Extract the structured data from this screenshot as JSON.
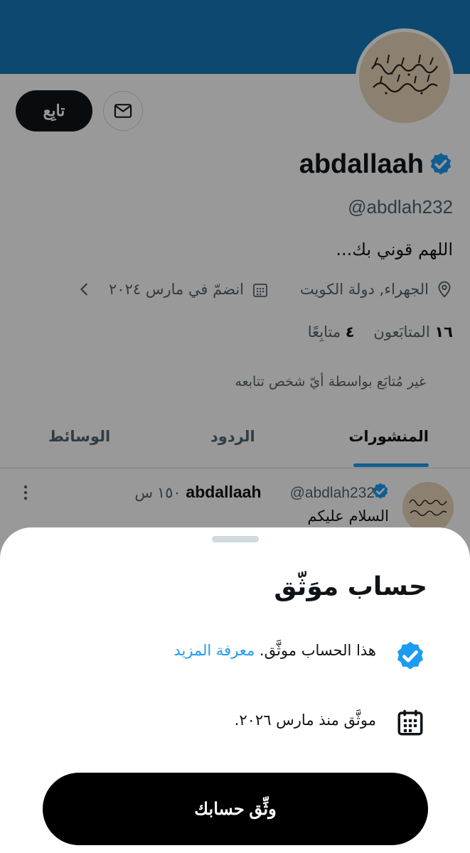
{
  "colors": {
    "banner": "#1479b9",
    "accent": "#1d9bf0",
    "text_primary": "#0f1419",
    "text_secondary": "#536471"
  },
  "profile": {
    "display_name": "abdallaah",
    "handle": "@abdlah232",
    "bio": "اللهم قوني بك...",
    "location": "الجهراء, دولة الكويت",
    "joined": "انضمّ في مارس ٢٠٢٤",
    "followers_count": "١٦",
    "followers_label": "المتابَعون",
    "following_count": "٤",
    "following_label": "متابِعًا",
    "not_followed_note": "غير مُتابَع بواسطة أيّ شخص تتابعه",
    "follow_button": "تابِع",
    "icons": {
      "message": "mail-icon",
      "location": "location-pin-icon",
      "joined": "calendar-icon",
      "expand": "chevron-left-icon",
      "verified": "verified-badge-icon"
    }
  },
  "tabs": [
    {
      "label": "المنشورات",
      "active": true
    },
    {
      "label": "الردود",
      "active": false
    },
    {
      "label": "الوسائط",
      "active": false
    }
  ],
  "post": {
    "name": "abdallaah",
    "handle": "@abdlah232",
    "time": "١٥٠ س",
    "text": "السلام عليكم"
  },
  "sheet": {
    "title": "حساب موَثّق",
    "verified_text": "هذا الحساب موثَّق.",
    "learn_more": "معرفة المزيد",
    "since_text": "موثَّق منذ مارس ٢٠٢٦.",
    "button": "وثِّق حسابك"
  }
}
